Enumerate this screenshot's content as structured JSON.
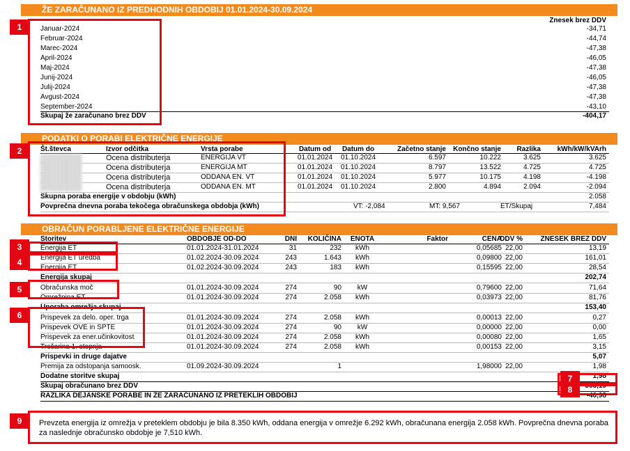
{
  "section1": {
    "title": "ŽE ZARAČUNANO IZ PREDHODNIH OBDOBIJ 01.01.2024-30.09.2024",
    "col_header": "Znesek brez DDV",
    "rows": [
      {
        "label": "Januar-2024",
        "value": "-34,71"
      },
      {
        "label": "Februar-2024",
        "value": "-44,74"
      },
      {
        "label": "Marec-2024",
        "value": "-47,38"
      },
      {
        "label": "April-2024",
        "value": "-46,05"
      },
      {
        "label": "Maj-2024",
        "value": "-47,38"
      },
      {
        "label": "Junij-2024",
        "value": "-46,05"
      },
      {
        "label": "Julij-2024",
        "value": "-47,38"
      },
      {
        "label": "Avgust-2024",
        "value": "-47,38"
      },
      {
        "label": "September-2024",
        "value": "-43,10"
      }
    ],
    "total": {
      "label": "Skupaj že zaračunano brez DDV",
      "value": "-404,17"
    }
  },
  "section2": {
    "title": "PODATKI O PORABI ELEKTRIČNE ENERGIJE",
    "headers": [
      "Št.števca",
      "Izvor odčitka",
      "Vrsta porabe",
      "Datum od",
      "Datum do",
      "Začetno stanje",
      "Končno stanje",
      "Razlika",
      "kWh/kW/kVArh"
    ],
    "rows": [
      {
        "izvor": "Ocena distributerja",
        "vrsta": "ENERGIJA VT",
        "od": "01.01.2024",
        "do": "01.10.2024",
        "zac": "6.597",
        "kon": "10.222",
        "raz": "3.625",
        "kwh": "3.625"
      },
      {
        "izvor": "Ocena distributerja",
        "vrsta": "ENERGIJA MT",
        "od": "01.01.2024",
        "do": "01.10.2024",
        "zac": "8.797",
        "kon": "13.522",
        "raz": "4.725",
        "kwh": "4.725"
      },
      {
        "izvor": "Ocena distributerja",
        "vrsta": "ODDANA EN. VT",
        "od": "01.01.2024",
        "do": "01.10.2024",
        "zac": "5.977",
        "kon": "10.175",
        "raz": "4.198",
        "kwh": "-4.198"
      },
      {
        "izvor": "Ocena distributerja",
        "vrsta": "ODDANA EN. MT",
        "od": "01.01.2024",
        "do": "01.10.2024",
        "zac": "2.800",
        "kon": "4.894",
        "raz": "2.094",
        "kwh": "-2.094"
      }
    ],
    "skupna": {
      "label": "Skupna poraba energije v obdobju (kWh)",
      "value": "2.058"
    },
    "povprecna": {
      "label": "Povprečna dnevna poraba tekočega obračunskega obdobja (kWh)",
      "vt": "VT: -2,084",
      "mt": "MT: 9,567",
      "et": "ET/Skupaj",
      "value": "7,484"
    }
  },
  "section3": {
    "title": "OBRAČUN PORABLJENE ELEKTRIČNE ENERGIJE",
    "headers": {
      "storitev": "Storitev",
      "obdobje": "OBDOBJE OD-DO",
      "dni": "DNI",
      "kolicina": "KOLIČINA",
      "enota": "ENOTA",
      "faktor": "Faktor",
      "cena": "CENA",
      "ddv": "DDV %",
      "znesek": "ZNESEK BREZ DDV"
    },
    "energija": [
      {
        "name": "Energija ET",
        "obdobje": "01.01.2024-31.01.2024",
        "dni": "31",
        "kol": "232",
        "enota": "kWh",
        "cena": "0,05685",
        "ddv": "22,00",
        "znesek": "13,19"
      },
      {
        "name": "Energija ET uredba",
        "obdobje": "01.02.2024-30.09.2024",
        "dni": "243",
        "kol": "1.643",
        "enota": "kWh",
        "cena": "0,09800",
        "ddv": "22,00",
        "znesek": "161,01"
      },
      {
        "name": "Energija ET",
        "obdobje": "01.02.2024-30.09.2024",
        "dni": "243",
        "kol": "183",
        "enota": "kWh",
        "cena": "0,15595",
        "ddv": "22,00",
        "znesek": "28,54"
      }
    ],
    "energija_skupaj": {
      "label": "Energija skupaj",
      "value": "202,74"
    },
    "omrezje": [
      {
        "name": "Obračunska moč",
        "obdobje": "01.01.2024-30.09.2024",
        "dni": "274",
        "kol": "90",
        "enota": "kW",
        "cena": "0,79600",
        "ddv": "22,00",
        "znesek": "71,64"
      },
      {
        "name": "Omrežnina ET",
        "obdobje": "01.01.2024-30.09.2024",
        "dni": "274",
        "kol": "2.058",
        "enota": "kWh",
        "cena": "0,03973",
        "ddv": "22,00",
        "znesek": "81,76"
      }
    ],
    "omrezje_skupaj": {
      "label": "Uporaba omrežja skupaj",
      "value": "153,40"
    },
    "prispevki": [
      {
        "name": "Prispevek za delo. oper. trga",
        "obdobje": "01.01.2024-30.09.2024",
        "dni": "274",
        "kol": "2.058",
        "enota": "kWh",
        "cena": "0,00013",
        "ddv": "22,00",
        "znesek": "0,27"
      },
      {
        "name": "Prispevek OVE in SPTE",
        "obdobje": "01.01.2024-30.09.2024",
        "dni": "274",
        "kol": "90",
        "enota": "kW",
        "cena": "0,00000",
        "ddv": "22,00",
        "znesek": "0,00"
      },
      {
        "name": "Prispevek za ener.učinkovitost",
        "obdobje": "01.01.2024-30.09.2024",
        "dni": "274",
        "kol": "2.058",
        "enota": "kWh",
        "cena": "0,00080",
        "ddv": "22,00",
        "znesek": "1,65"
      },
      {
        "name": "Trošarina 1. stopnja",
        "obdobje": "01.01.2024-30.09.2024",
        "dni": "274",
        "kol": "2.058",
        "enota": "kWh",
        "cena": "0,00153",
        "ddv": "22,00",
        "znesek": "3,15"
      }
    ],
    "prispevki_skupaj": {
      "label": "Prispevki in druge dajatve",
      "value": "5,07"
    },
    "dodatne": [
      {
        "name": "Premija za odstopanja samoosk.",
        "obdobje": "01.09.2024-30.09.2024",
        "dni": "",
        "kol": "1",
        "enota": "",
        "cena": "1,98000",
        "ddv": "22,00",
        "znesek": "1,98"
      }
    ],
    "dodatne_skupaj": {
      "label": "Dodatne storitve skupaj",
      "value": "1,98"
    },
    "skupaj": {
      "label": "Skupaj obračunano brez DDV",
      "value": "363,19"
    },
    "razlika": {
      "label": "RAZLIKA DEJANSKE PORABE IN ŽE ZARAČUNANO IZ PRETEKLIH OBDOBIJ",
      "value": "-40,98"
    }
  },
  "note": "Prevzeta energija iz omrežja v preteklem obdobju je bila 8.350 kWh, oddana energija v omrežje 6.292 kWh, obračunana energija 2.058 kWh. Povprečna dnevna poraba za naslednje obračunsko obdobje je 7,510 kWh.",
  "badges": [
    "1",
    "2",
    "3",
    "4",
    "5",
    "6",
    "7",
    "8",
    "9"
  ],
  "colors": {
    "orange": "#f28a1e",
    "red": "#e30613"
  }
}
